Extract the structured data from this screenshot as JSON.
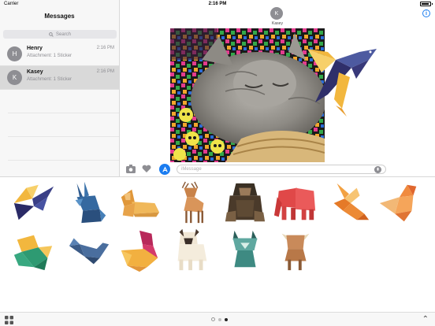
{
  "status_bar": {
    "carrier": "Carrier",
    "time": "2:16 PM"
  },
  "sidebar": {
    "title": "Messages",
    "search_placeholder": "Search",
    "conversations": [
      {
        "initial": "H",
        "name": "Henry",
        "preview": "Attachment: 1 Sticker",
        "time": "2:16 PM",
        "selected": false
      },
      {
        "initial": "K",
        "name": "Kasey",
        "preview": "Attachment: 1 Sticker",
        "time": "2:16 PM",
        "selected": true
      }
    ]
  },
  "conversation": {
    "contact_initial": "K",
    "contact_name": "Kasey",
    "info_label": "i",
    "message_placeholder": "iMessage"
  },
  "sticker_tray": {
    "stickers": [
      "swallow-sticker",
      "rabbit-sticker",
      "lion-sticker",
      "deer-sticker",
      "chimpanzee-sticker",
      "elephant-sticker",
      "orange-bird-sticker",
      "robin-sticker",
      "green-bird-sticker",
      "blue-bird-sticker",
      "duck-sticker",
      "pug-sticker",
      "lynx-sticker",
      "highland-cow-sticker"
    ]
  },
  "colors": {
    "accent": "#1a7cf0",
    "sidebar_bg": "#f7f7f7",
    "selected_row": "#d9d9d9"
  }
}
